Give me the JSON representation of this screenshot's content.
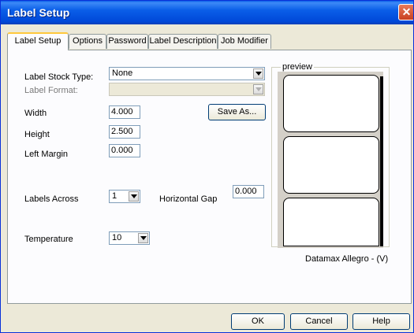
{
  "window": {
    "title": "Label Setup",
    "close_glyph": "✕"
  },
  "tabs": [
    {
      "label": "Label Setup",
      "active": true
    },
    {
      "label": "Options",
      "active": false
    },
    {
      "label": "Password",
      "active": false
    },
    {
      "label": "Label Description",
      "active": false
    },
    {
      "label": "Job Modifier",
      "active": false
    }
  ],
  "form": {
    "label_stock_type_label": "Label Stock Type:",
    "label_stock_type_value": "None",
    "label_format_label": "Label Format:",
    "label_format_value": "",
    "width_label": "Width",
    "width_value": "4.000",
    "height_label": "Height",
    "height_value": "2.500",
    "left_margin_label": "Left Margin",
    "left_margin_value": "0.000",
    "save_as_label": "Save As...",
    "labels_across_label": "Labels Across",
    "labels_across_value": "1",
    "horizontal_gap_label": "Horizontal Gap",
    "horizontal_gap_value": "0.000",
    "temperature_label": "Temperature",
    "temperature_value": "10"
  },
  "preview": {
    "caption": "preview",
    "printer_name": "Datamax Allegro - (V)"
  },
  "footer": {
    "ok_label": "OK",
    "cancel_label": "Cancel",
    "help_label": "Help"
  },
  "colors": {
    "titlebar": "#0a5ee8",
    "dialog_background": "#ece9d8",
    "panel_background": "#fcfcfe",
    "active_tab_highlight": "#ffc83c"
  }
}
